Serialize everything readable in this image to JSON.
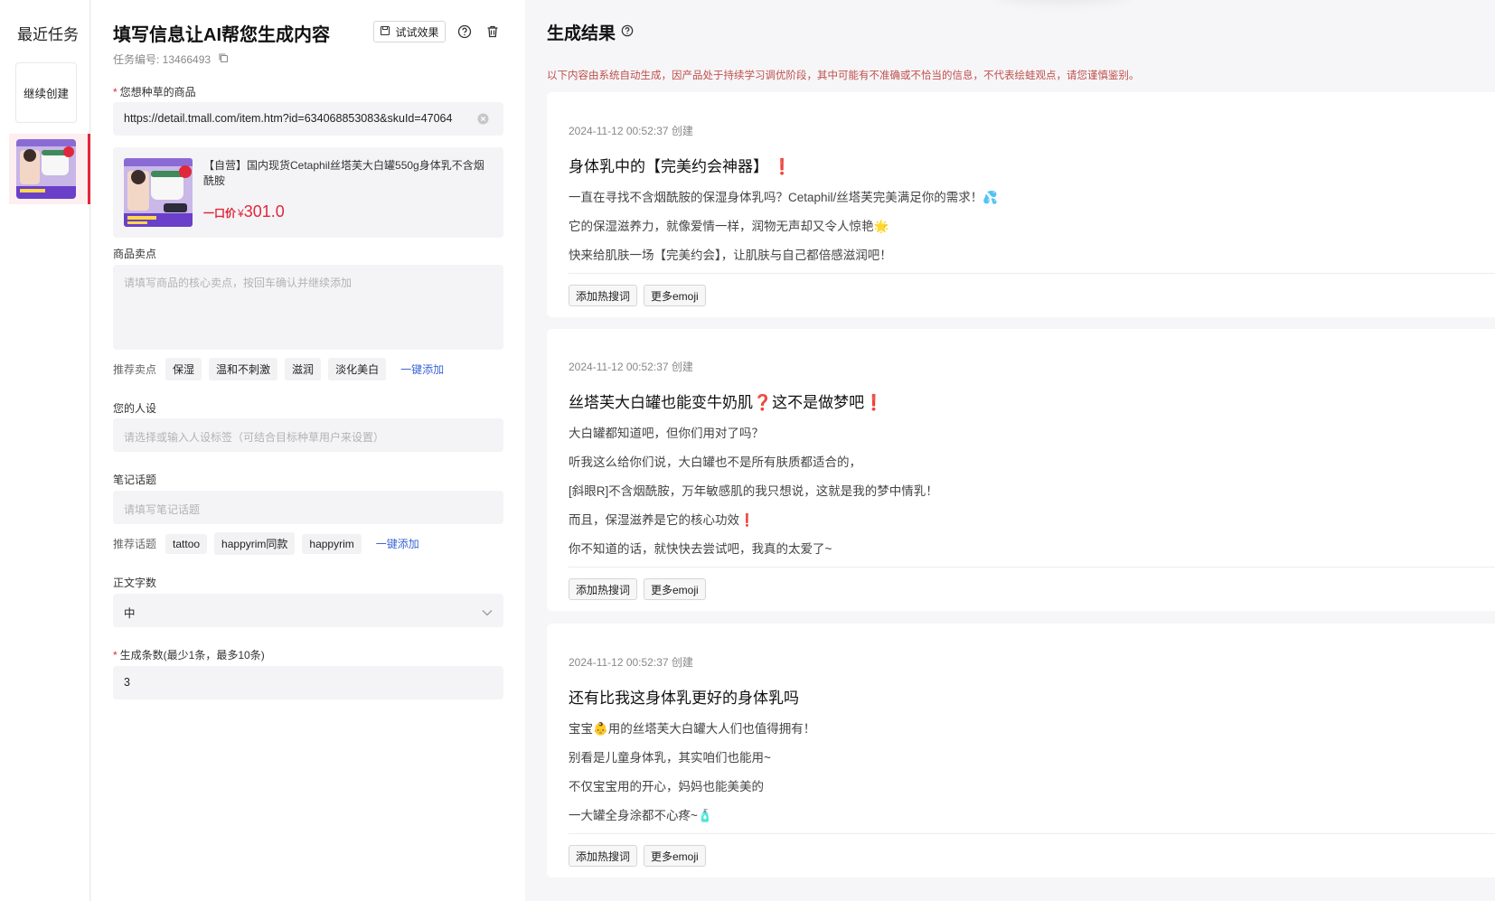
{
  "sidebar": {
    "title": "最近任务",
    "continue_label": "继续创建"
  },
  "form": {
    "title": "填写信息让AI帮您生成内容",
    "try_label": "试试效果",
    "task_no_label": "任务编号: 13466493",
    "product": {
      "label": "您想种草的商品",
      "url": "https://detail.tmall.com/item.htm?id=634068853083&skuId=47064",
      "name": "【自营】国内现货Cetaphil丝塔芙大白罐550g身体乳不含烟酰胺",
      "price_label": "一口价",
      "currency": "¥",
      "price": "301.0"
    },
    "selling_points": {
      "label": "商品卖点",
      "placeholder": "请填写商品的核心卖点，按回车确认并继续添加",
      "recommend_label": "推荐卖点",
      "tags": [
        "保湿",
        "温和不刺激",
        "滋润",
        "淡化美白"
      ],
      "add_all": "一键添加"
    },
    "persona": {
      "label": "您的人设",
      "placeholder": "请选择或输入人设标签（可结合目标种草用户来设置）"
    },
    "topic": {
      "label": "笔记话题",
      "placeholder": "请填写笔记话题",
      "recommend_label": "推荐话题",
      "tags": [
        "tattoo",
        "happyrim同款",
        "happyrim"
      ],
      "add_all": "一键添加"
    },
    "word_count": {
      "label": "正文字数",
      "value": "中"
    },
    "count": {
      "label": "生成条数(最少1条，最多10条)",
      "value": "3"
    }
  },
  "results": {
    "title": "生成结果",
    "disclaimer": "以下内容由系统自动生成，因产品处于持续学习调优阶段，其中可能有不准确或不恰当的信息，不代表绘蛙观点，请您谨慎鉴别。",
    "hot_label": "添加热搜词",
    "emoji_label": "更多emoji",
    "cards": [
      {
        "time": "2024-11-12 00:52:37 创建",
        "title": "身体乳中的【完美约会神器】",
        "lines": [
          "一直在寻找不含烟酰胺的保湿身体乳吗？Cetaphil/丝塔芙完美满足你的需求！💦",
          "它的保湿滋养力，就像爱情一样，润物无声却又令人惊艳🌟",
          "快来给肌肤一场【完美约会】，让肌肤与自己都倍感滋润吧！"
        ]
      },
      {
        "time": "2024-11-12 00:52:37 创建",
        "title": "丝塔芙大白罐也能变牛奶肌",
        "title_mid": "这不是做梦吧",
        "lines": [
          "大白罐都知道吧，但你们用对了吗？",
          "听我这么给你们说，大白罐也不是所有肤质都适合的，",
          "[斜眼R]不含烟酰胺，万年敏感肌的我只想说，这就是我的梦中情乳！",
          "而且，保湿滋养是它的核心功效",
          "你不知道的话，就快快去尝试吧，我真的太爱了~"
        ]
      },
      {
        "time": "2024-11-12 00:52:37 创建",
        "title": "还有比我这身体乳更好的身体乳吗",
        "lines": [
          "宝宝👶用的丝塔芙大白罐大人们也值得拥有！",
          "别看是儿童身体乳，其实咱们也能用~",
          "不仅宝宝用的开心，妈妈也能美美的",
          "一大罐全身涂都不心疼~🧴"
        ]
      }
    ]
  }
}
